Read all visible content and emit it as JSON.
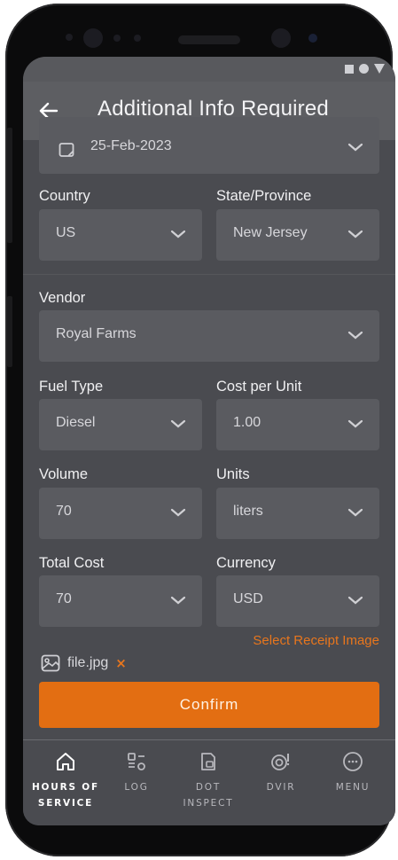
{
  "header": {
    "title": "Additional Info Required"
  },
  "form": {
    "date": {
      "value": "25-Feb-2023"
    },
    "country": {
      "label": "Country",
      "value": "US"
    },
    "state": {
      "label": "State/Province",
      "value": "New Jersey"
    },
    "vendor": {
      "label": "Vendor",
      "value": "Royal Farms"
    },
    "fuel_type": {
      "label": "Fuel Type",
      "value": "Diesel"
    },
    "cost_per_unit": {
      "label": "Cost per Unit",
      "value": "1.00"
    },
    "volume": {
      "label": "Volume",
      "value": "70"
    },
    "units": {
      "label": "Units",
      "value": "liters"
    },
    "total_cost": {
      "label": "Total Cost",
      "value": "70"
    },
    "currency": {
      "label": "Currency",
      "value": "USD"
    }
  },
  "receipt": {
    "link_label": "Select Receipt Image",
    "file_name": "file.jpg",
    "remove_symbol": "×"
  },
  "confirm_label": "Confirm",
  "nav": [
    {
      "label": "HOURS OF SERVICE",
      "icon": "home-icon",
      "active": true
    },
    {
      "label": "LOG",
      "icon": "log-icon"
    },
    {
      "label": "DOT INSPECT",
      "icon": "dot-inspect-icon"
    },
    {
      "label": "DVIR",
      "icon": "dvir-icon"
    },
    {
      "label": "MENU",
      "icon": "menu-icon"
    }
  ],
  "colors": {
    "accent": "#e36e12",
    "background": "#4a4b50",
    "field": "#5a5b60"
  }
}
